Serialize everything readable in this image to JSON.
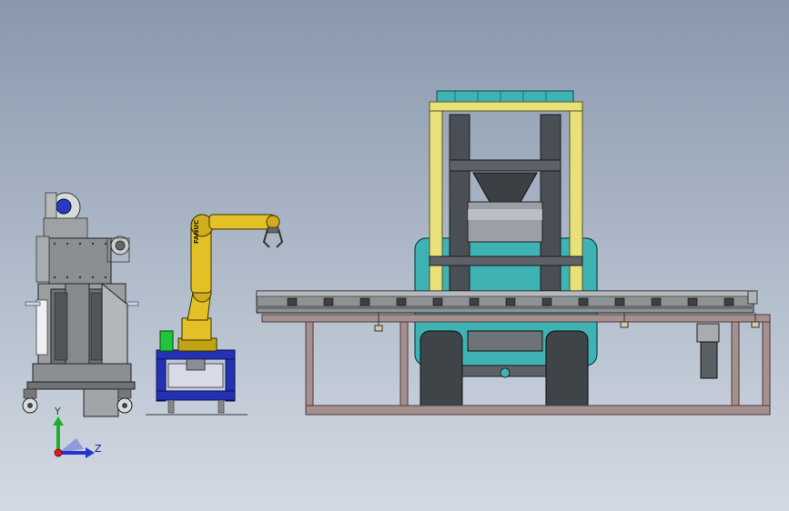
{
  "colors": {
    "background_top": "#8a98ad",
    "background_bottom": "#d3dae3",
    "frame_steel": "#7d6a6a",
    "frame_highlight": "#a58f8f",
    "robot_yellow": "#e3c126",
    "robot_base_blue": "#2332b5",
    "gantry_yellow": "#e8e07a",
    "gantry_dark": "#4a4f55",
    "cabin_teal": "#3fb2b4",
    "machine_gray": "#8b8f92",
    "conveyor_gray": "#8e9294",
    "motor_blue": "#2a3ac8",
    "axis_y": "#1fae2a",
    "axis_z": "#2435d0",
    "axis_x": "#d02020"
  },
  "robot": {
    "brand_text": "FANUC"
  },
  "axes": {
    "y_label": "Y",
    "z_label": "Z"
  },
  "icons": [
    "triad-axis-icon"
  ]
}
